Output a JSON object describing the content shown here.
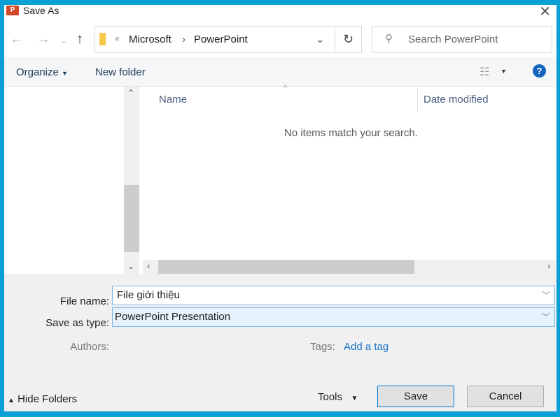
{
  "window": {
    "title": "Save As",
    "app_icon": "P"
  },
  "address": {
    "path": [
      "Microsoft",
      "PowerPoint"
    ],
    "overflow": "«"
  },
  "search": {
    "placeholder": "Search PowerPoint"
  },
  "toolbar": {
    "organize": "Organize",
    "new_folder": "New folder"
  },
  "list": {
    "columns": [
      "Name",
      "Date modified"
    ],
    "empty_message": "No items match your search."
  },
  "form": {
    "file_name_label": "File name:",
    "file_name_value": "File giới thiệu",
    "type_label": "Save as type:",
    "type_value": "PowerPoint Presentation",
    "authors_label": "Authors:",
    "tags_label": "Tags:",
    "tags_link": "Add a tag"
  },
  "footer": {
    "hide_folders": "Hide Folders",
    "tools": "Tools",
    "save": "Save",
    "cancel": "Cancel"
  },
  "colors": {
    "frame": "#0aa0d6",
    "link": "#1a73c8",
    "help": "#1565c0"
  }
}
